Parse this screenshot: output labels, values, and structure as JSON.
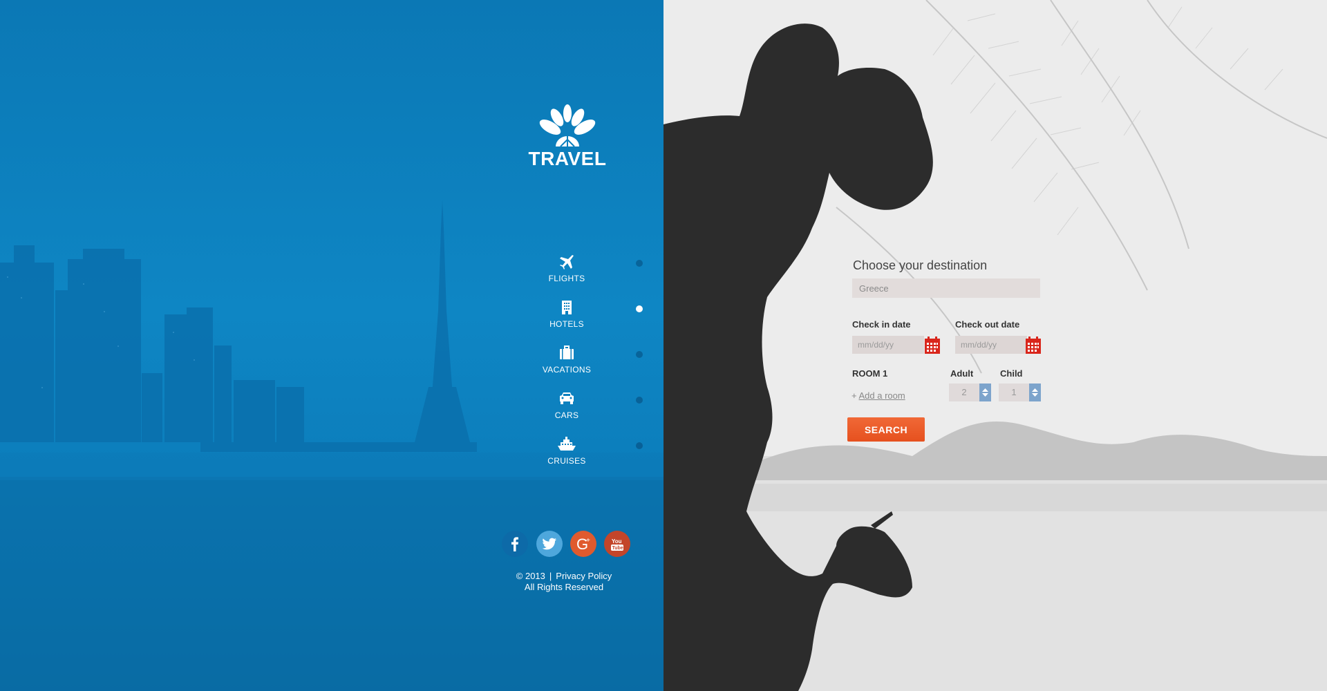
{
  "brand": {
    "name": "TRAVEL"
  },
  "nav": {
    "items": [
      {
        "label": "FLIGHTS",
        "icon": "airplane-icon"
      },
      {
        "label": "HOTELS",
        "icon": "hotel-building-icon"
      },
      {
        "label": "VACATIONS",
        "icon": "suitcase-icon"
      },
      {
        "label": "CARS",
        "icon": "car-icon"
      },
      {
        "label": "CRUISES",
        "icon": "cruise-ship-icon"
      }
    ],
    "active_index": 1
  },
  "social": [
    {
      "name": "facebook",
      "icon": "facebook-icon",
      "color": "#0d6aa8"
    },
    {
      "name": "twitter",
      "icon": "twitter-icon",
      "color": "#4ea7dc"
    },
    {
      "name": "google-plus",
      "icon": "google-plus-icon",
      "color": "#e05a2e"
    },
    {
      "name": "youtube",
      "icon": "youtube-icon",
      "color": "#c3452a"
    }
  ],
  "footer": {
    "copyright": "© 2013",
    "separator": "|",
    "privacy": "Privacy Policy",
    "rights": "All Rights Reserved"
  },
  "form": {
    "title": "Choose your destination",
    "destination_placeholder": "Greece",
    "checkin_label": "Check in date",
    "checkout_label": "Check out date",
    "date_placeholder": "mm/dd/yy",
    "room_label": "ROOM 1",
    "add_room_prefix": "+",
    "add_room_label": "Add a room",
    "adult_label": "Adult",
    "child_label": "Child",
    "adult_value": "2",
    "child_value": "1",
    "search_label": "SEARCH"
  },
  "colors": {
    "left_panel": "#0e86c4",
    "accent_orange": "#e6511f",
    "calendar_red": "#d9261c",
    "select_arrow": "#7da4cc"
  }
}
